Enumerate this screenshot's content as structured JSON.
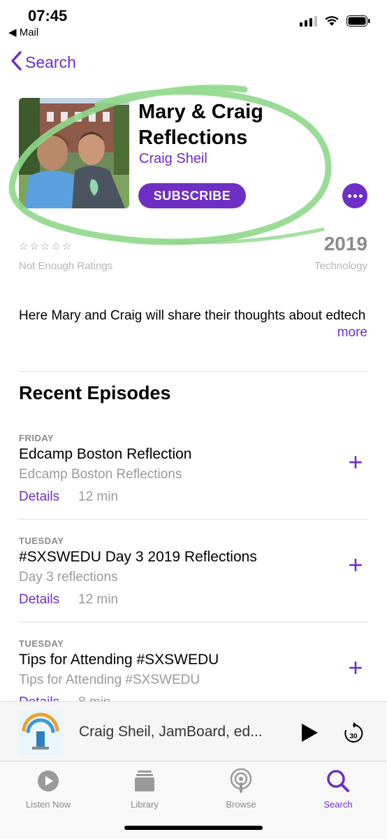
{
  "status": {
    "time": "07:45",
    "back_app": "◀ Mail"
  },
  "nav": {
    "back_label": "Search"
  },
  "podcast": {
    "title": "Mary & Craig Reflections",
    "author": "Craig Sheil",
    "subscribe_label": "SUBSCRIBE",
    "stars": "☆☆☆☆☆",
    "ratings_text": "Not Enough Ratings",
    "year": "2019",
    "category": "Technology",
    "description": "Here Mary and Craig will share their thoughts about edtech",
    "more_label": "more"
  },
  "episodes_section": {
    "title": "Recent Episodes",
    "episodes": [
      {
        "date": "FRIDAY",
        "title": "Edcamp Boston Reflection",
        "subtitle": "Edcamp Boston Reflections",
        "details_label": "Details",
        "duration": "12 min"
      },
      {
        "date": "TUESDAY",
        "title": "#SXSWEDU Day 3 2019 Reflections",
        "subtitle": "Day 3 reflections",
        "details_label": "Details",
        "duration": "12 min"
      },
      {
        "date": "TUESDAY",
        "title": "Tips for Attending #SXSWEDU",
        "subtitle": "Tips for Attending #SXSWEDU",
        "details_label": "Details",
        "duration": "8 min"
      }
    ]
  },
  "mini_player": {
    "title": "Craig Sheil, JamBoard, ed...",
    "skip_seconds": "30"
  },
  "tabs": [
    {
      "label": "Listen Now",
      "icon": "play-circle-icon"
    },
    {
      "label": "Library",
      "icon": "library-stack-icon"
    },
    {
      "label": "Browse",
      "icon": "podcast-broadcast-icon"
    },
    {
      "label": "Search",
      "icon": "magnifier-icon"
    }
  ],
  "colors": {
    "accent": "#6e2fc4",
    "highlight_circle": "#8fd88a"
  }
}
